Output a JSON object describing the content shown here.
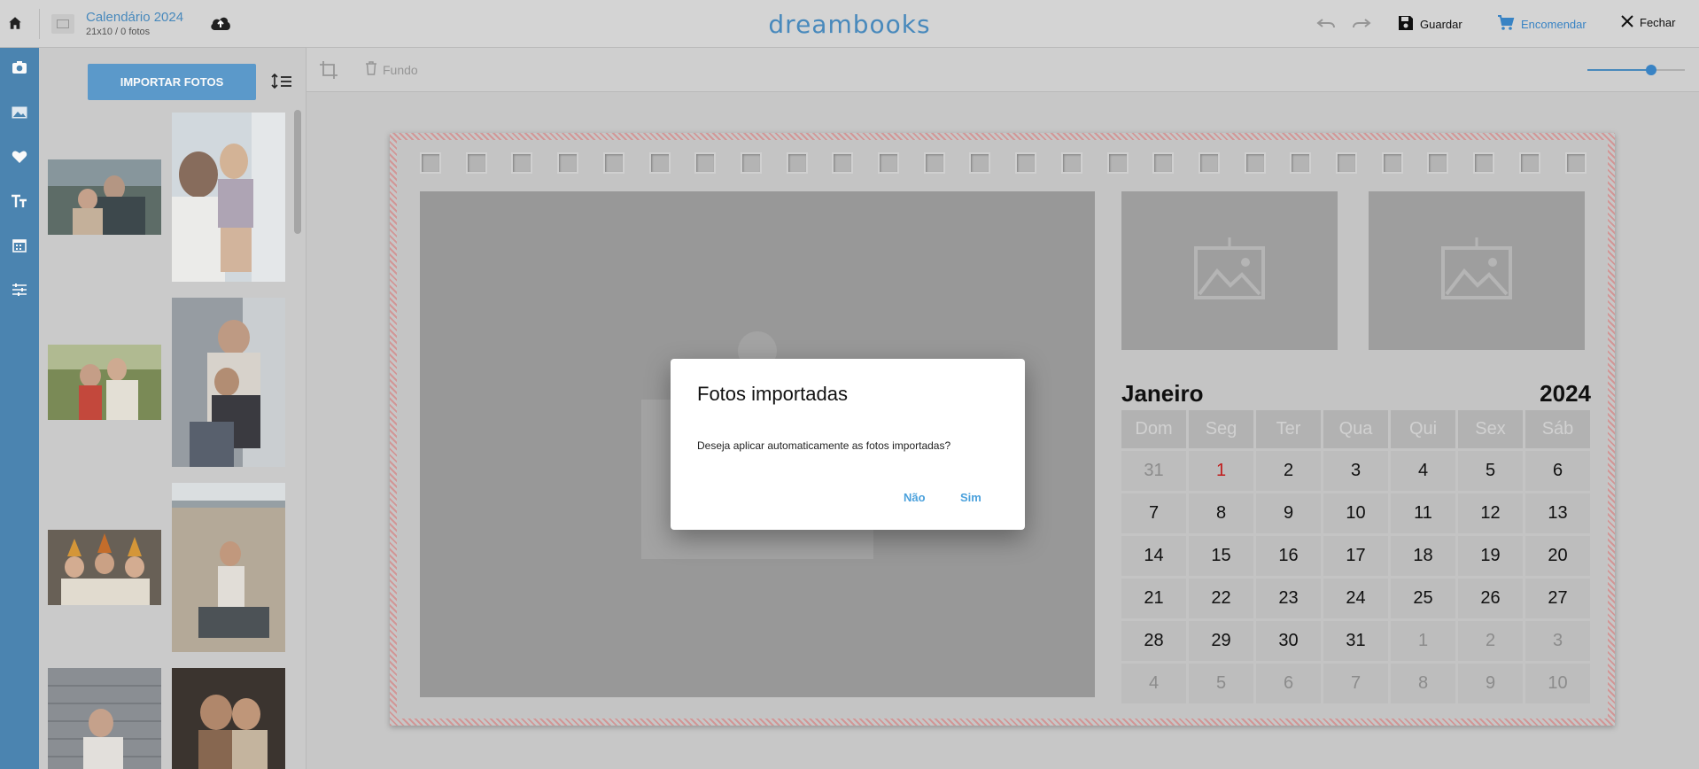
{
  "topbar": {
    "project_title": "Calendário 2024",
    "project_sub": "21x10 / 0 fotos",
    "brand": "dreambooks",
    "save_label": "Guardar",
    "order_label": "Encomendar",
    "close_label": "Fechar"
  },
  "panel": {
    "import_label": "IMPORTAR FOTOS"
  },
  "toolbar": {
    "background_label": "Fundo",
    "zoom": 0.65
  },
  "calendar": {
    "month": "Janeiro",
    "year": "2024",
    "weekdays": [
      "Dom",
      "Seg",
      "Ter",
      "Qua",
      "Qui",
      "Sex",
      "Sáb"
    ],
    "weeks": [
      [
        "31",
        "1",
        "2",
        "3",
        "4",
        "5",
        "6"
      ],
      [
        "7",
        "8",
        "9",
        "10",
        "11",
        "12",
        "13"
      ],
      [
        "14",
        "15",
        "16",
        "17",
        "18",
        "19",
        "20"
      ],
      [
        "21",
        "22",
        "23",
        "24",
        "25",
        "26",
        "27"
      ],
      [
        "28",
        "29",
        "30",
        "31",
        "1",
        "2",
        "3"
      ],
      [
        "4",
        "5",
        "6",
        "7",
        "8",
        "9",
        "10"
      ]
    ]
  },
  "dialog": {
    "title": "Fotos importadas",
    "message": "Deseja aplicar automaticamente as fotos importadas?",
    "no_label": "Não",
    "yes_label": "Sim"
  },
  "colors": {
    "accent": "#4a8cc0",
    "rail": "#4d87b4",
    "button": "#5d9dcf",
    "dialog_button": "#4ba1dc",
    "holiday": "#c41e1e"
  }
}
